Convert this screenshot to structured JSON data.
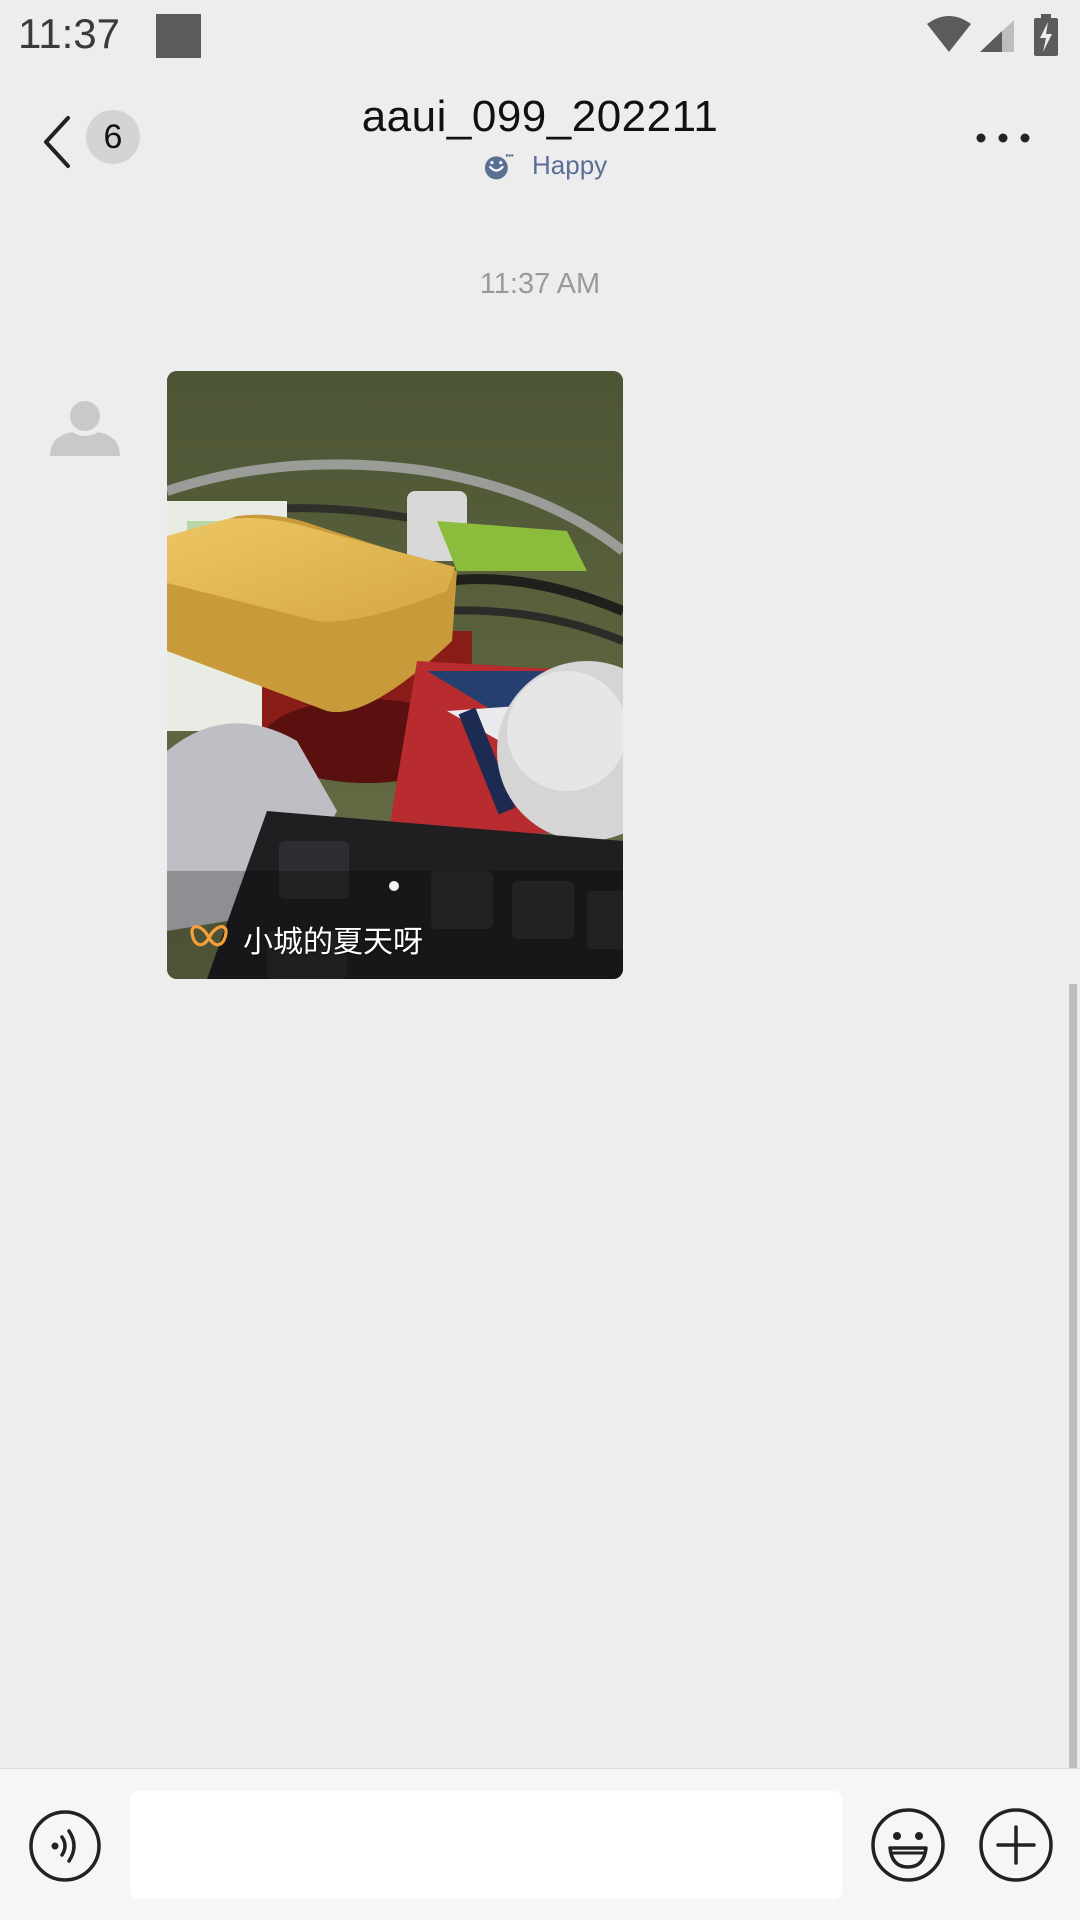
{
  "status_bar": {
    "time": "11:37",
    "icons": [
      "notification-square-icon",
      "wifi-icon",
      "cell-signal-icon",
      "battery-charging-icon"
    ]
  },
  "header": {
    "back_icon": "chevron-left-icon",
    "unread_count": "6",
    "title": "aaui_099_202211",
    "status_icon": "smiley-mood-icon",
    "status_text": "Happy",
    "more_icon": "more-dots-icon"
  },
  "chat": {
    "timestamp": "11:37 AM",
    "messages": [
      {
        "type": "media",
        "avatar_icon": "default-avatar-icon",
        "caption": "小城的夏天呀",
        "caption_icon": "channel-butterfly-icon",
        "image_subject": "sponge on red container beside keyboard"
      }
    ]
  },
  "input_bar": {
    "voice_icon": "voice-input-icon",
    "input_value": "",
    "emoji_icon": "emoji-icon",
    "more_icon": "plus-icon"
  },
  "colors": {
    "background": "#ededed",
    "status_text": "#5b6f94",
    "caption_logo": "#f5a03a",
    "input_bar": "#f6f6f6"
  }
}
